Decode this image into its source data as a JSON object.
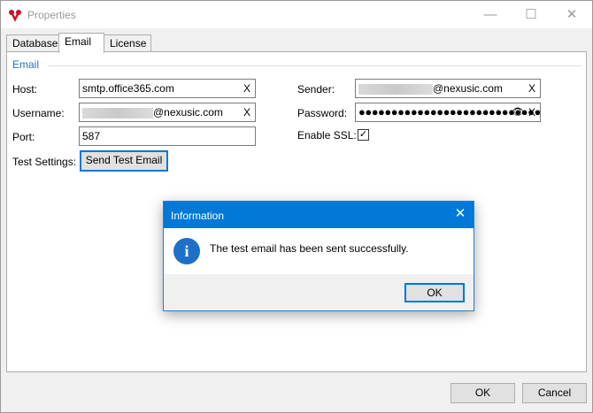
{
  "window": {
    "title": "Properties"
  },
  "tabs": [
    {
      "label": "Database"
    },
    {
      "label": "Email"
    },
    {
      "label": "License"
    }
  ],
  "group": {
    "title": "Email"
  },
  "form": {
    "host_label": "Host:",
    "host_value": "smtp.office365.com",
    "username_label": "Username:",
    "username_suffix": "@nexusic.com",
    "port_label": "Port:",
    "port_value": "587",
    "test_label": "Test Settings:",
    "send_button": "Send Test Email",
    "sender_label": "Sender:",
    "sender_suffix": "@nexusic.com",
    "password_label": "Password:",
    "password_dots": "●●●●●●●●●●●●●●●●●●●●●●●●●●●●●●●",
    "ssl_label": "Enable SSL:",
    "clear_glyph": "X",
    "check_glyph": "✓"
  },
  "footer": {
    "ok_label": "OK",
    "cancel_label": "Cancel"
  },
  "dialog": {
    "title": "Information",
    "message": "The test email has been sent successfully.",
    "ok_label": "OK",
    "icon_glyph": "i",
    "close_glyph": "✕"
  },
  "colors": {
    "accent": "#0078d7",
    "group_title": "#1e74c6"
  }
}
